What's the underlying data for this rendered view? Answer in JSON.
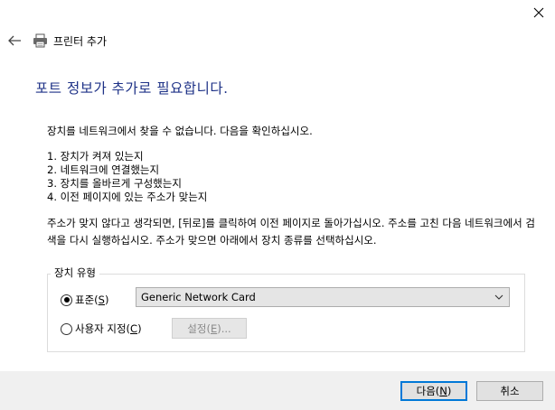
{
  "titlebar": {
    "back_icon": "arrow-left-icon",
    "printer_icon": "printer-icon",
    "title": "프린터 추가",
    "close_icon": "close-icon"
  },
  "heading": "포트 정보가 추가로 필요합니다.",
  "message": "장치를 네트워크에서 찾을 수 없습니다. 다음을 확인하십시오.",
  "checklist": [
    "1.  장치가 켜져 있는지",
    "2.  네트워크에 연결했는지",
    "3.  장치를 올바르게 구성했는지",
    "4.  이전 페이지에 있는 주소가 맞는지"
  ],
  "note": "주소가 맞지 않다고 생각되면, [뒤로]를 클릭하여 이전 페이지로 돌아가십시오. 주소를 고친 다음 네트워크에서 검색을 다시 실행하십시오. 주소가 맞으면 아래에서 장치 종류를 선택하십시오.",
  "device_type": {
    "legend": "장치 유형",
    "standard": {
      "label": "표준(",
      "accel": "S",
      "suffix": ")",
      "selected": true
    },
    "custom": {
      "label": "사용자 지정(",
      "accel": "C",
      "suffix": ")",
      "selected": false
    },
    "select_value": "Generic Network Card",
    "settings": {
      "label": "설정(",
      "accel": "E",
      "suffix": ")...",
      "enabled": false
    }
  },
  "footer": {
    "next": {
      "label": "다음(",
      "accel": "N",
      "suffix": ")"
    },
    "cancel": "취소"
  }
}
